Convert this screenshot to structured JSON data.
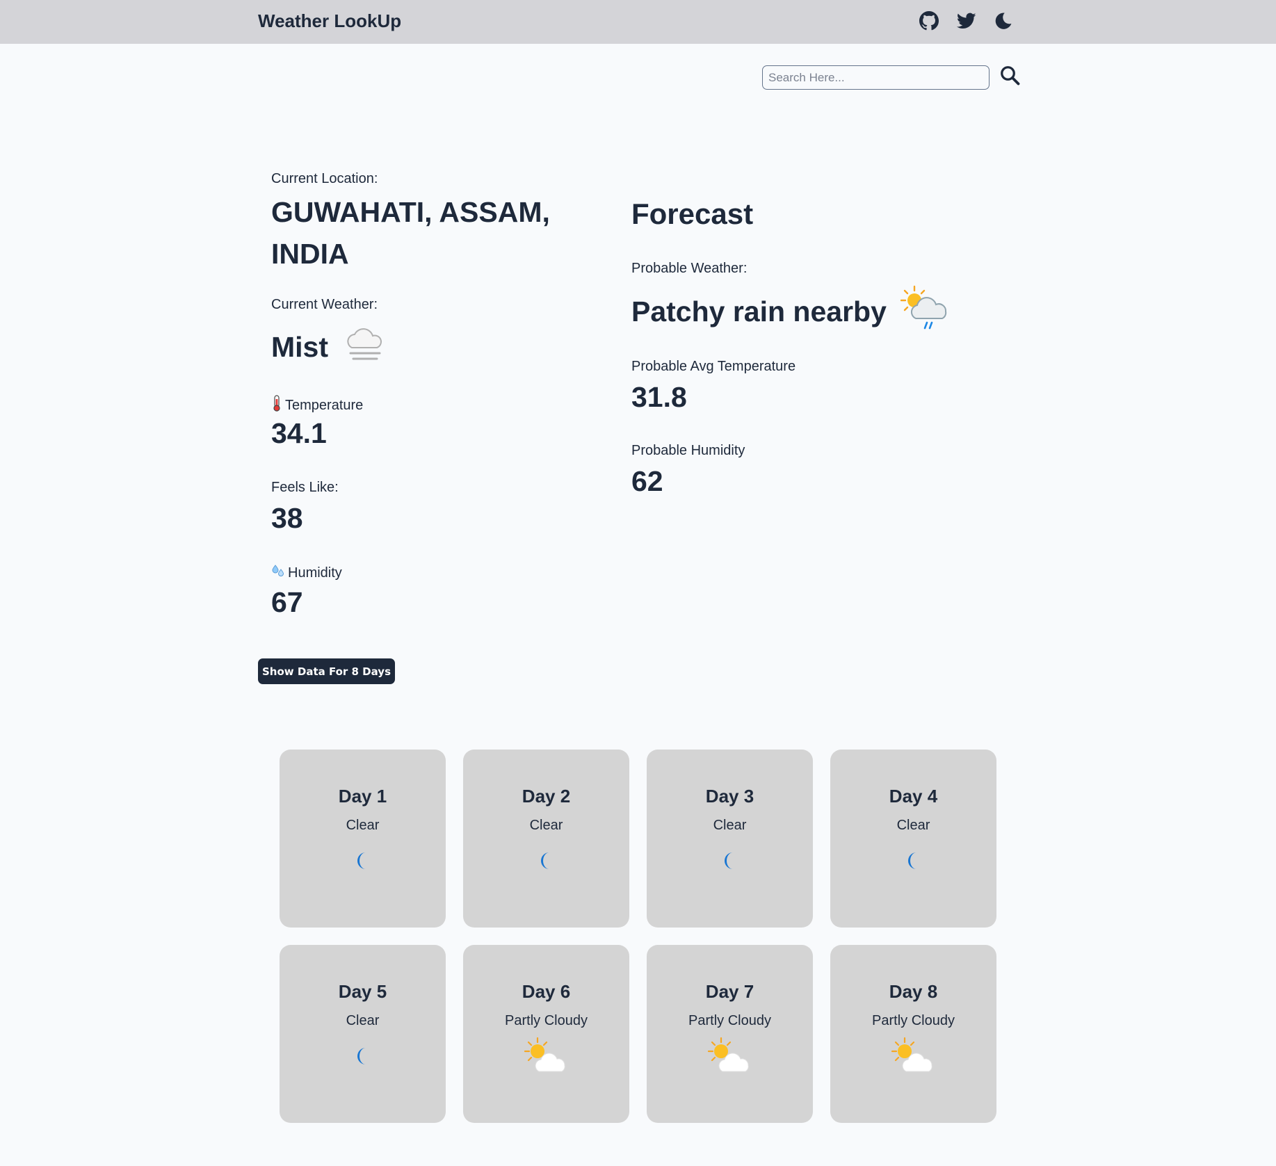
{
  "header": {
    "brand": "Weather LookUp",
    "icons": [
      "github-icon",
      "twitter-icon",
      "moon-icon"
    ]
  },
  "search": {
    "value": "",
    "placeholder": "Search Here..."
  },
  "current": {
    "location_label": "Current Location:",
    "location": "GUWAHATI, ASSAM, INDIA",
    "weather_label": "Current Weather:",
    "weather": "Mist",
    "weather_icon": "fog-icon",
    "temperature_label": "Temperature",
    "temperature": "34.1",
    "feels_like_label": "Feels Like:",
    "feels_like": "38",
    "humidity_label": "Humidity",
    "humidity": "67"
  },
  "forecast": {
    "title": "Forecast",
    "weather_label": "Probable Weather:",
    "weather": "Patchy rain nearby",
    "weather_icon": "sun-cloud-rain-icon",
    "avg_temp_label": "Probable Avg Temperature",
    "avg_temp": "31.8",
    "humidity_label": "Probable Humidity",
    "humidity": "62"
  },
  "show_button_label": "Show Data For 8 Days",
  "days": [
    {
      "title": "Day 1",
      "condition": "Clear",
      "icon": "crescent-moon-icon"
    },
    {
      "title": "Day 2",
      "condition": "Clear",
      "icon": "crescent-moon-icon"
    },
    {
      "title": "Day 3",
      "condition": "Clear",
      "icon": "crescent-moon-icon"
    },
    {
      "title": "Day 4",
      "condition": "Clear",
      "icon": "crescent-moon-icon"
    },
    {
      "title": "Day 5",
      "condition": "Clear",
      "icon": "crescent-moon-icon"
    },
    {
      "title": "Day 6",
      "condition": "Partly Cloudy",
      "icon": "sun-behind-cloud-icon"
    },
    {
      "title": "Day 7",
      "condition": "Partly Cloudy",
      "icon": "sun-behind-cloud-icon"
    },
    {
      "title": "Day 8",
      "condition": "Partly Cloudy",
      "icon": "sun-behind-cloud-icon"
    }
  ],
  "colors": {
    "navbar": "#d4d4d8",
    "background": "#f8fafc",
    "text": "#1e293b",
    "card": "#d4d4d4",
    "button": "#1e293b",
    "moon": "#1976d2",
    "sun": "#fbbf24"
  }
}
